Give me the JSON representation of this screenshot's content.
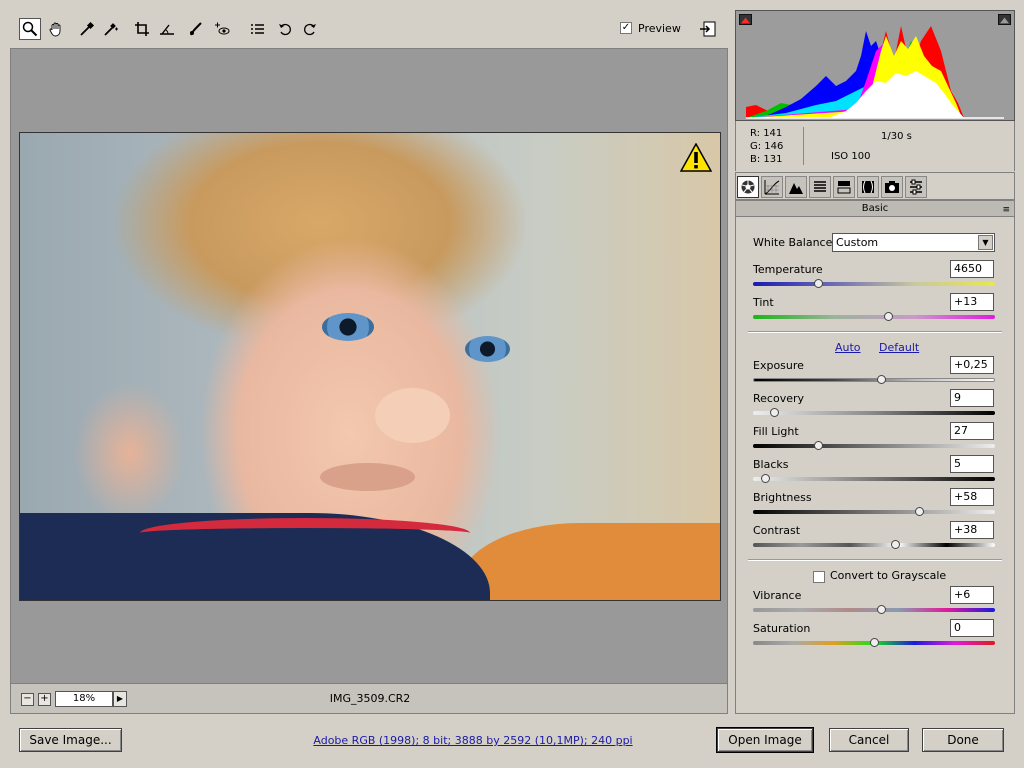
{
  "toolbar": {
    "tools": [
      "zoom-icon",
      "hand-icon",
      "white-balance-icon",
      "color-sampler-icon",
      "crop-icon",
      "straighten-icon",
      "retouch-icon",
      "red-eye-icon",
      "preferences-icon",
      "rotate-left-icon",
      "rotate-right-icon"
    ],
    "preview_label": "Preview",
    "preview_checked": "✓"
  },
  "status": {
    "zoom_value": "18%",
    "minus": "−",
    "plus": "+",
    "zoom_menu_arrow": "▶",
    "filename": "IMG_3509.CR2"
  },
  "info": {
    "r": "R:  141",
    "g": "G:  146",
    "b": "B:  131",
    "shutter": "1/30 s",
    "iso": "ISO 100"
  },
  "panel": {
    "title": "Basic",
    "menu_icon": "≡",
    "white_balance_label": "White Balance:",
    "white_balance_value": "Custom",
    "select_arrow": "▼",
    "auto_link": "Auto",
    "default_link": "Default",
    "grayscale_label": "Convert to Grayscale"
  },
  "sliders": {
    "temperature": {
      "label": "Temperature",
      "value": "4650",
      "fraction": 0.27
    },
    "tint": {
      "label": "Tint",
      "value": "+13",
      "fraction": 0.56
    },
    "exposure": {
      "label": "Exposure",
      "value": "+0,25",
      "fraction": 0.53
    },
    "recovery": {
      "label": "Recovery",
      "value": "9",
      "fraction": 0.09
    },
    "fill_light": {
      "label": "Fill Light",
      "value": "27",
      "fraction": 0.27
    },
    "blacks": {
      "label": "Blacks",
      "value": "5",
      "fraction": 0.05
    },
    "brightness": {
      "label": "Brightness",
      "value": "+58",
      "fraction": 0.69
    },
    "contrast": {
      "label": "Contrast",
      "value": "+38",
      "fraction": 0.59
    },
    "vibrance": {
      "label": "Vibrance",
      "value": "+6",
      "fraction": 0.53
    },
    "saturation": {
      "label": "Saturation",
      "value": "0",
      "fraction": 0.5
    }
  },
  "footer": {
    "save_label": "Save Image...",
    "color_space": "Adobe RGB (1998); 8 bit; 3888 by 2592 (10,1MP); 240 ppi",
    "open_label": "Open Image",
    "cancel_label": "Cancel",
    "done_label": "Done"
  },
  "colors": {
    "accent_link": "#1a1aa8",
    "panel_bg": "#d4d0c8",
    "preview_bg": "#999999"
  }
}
